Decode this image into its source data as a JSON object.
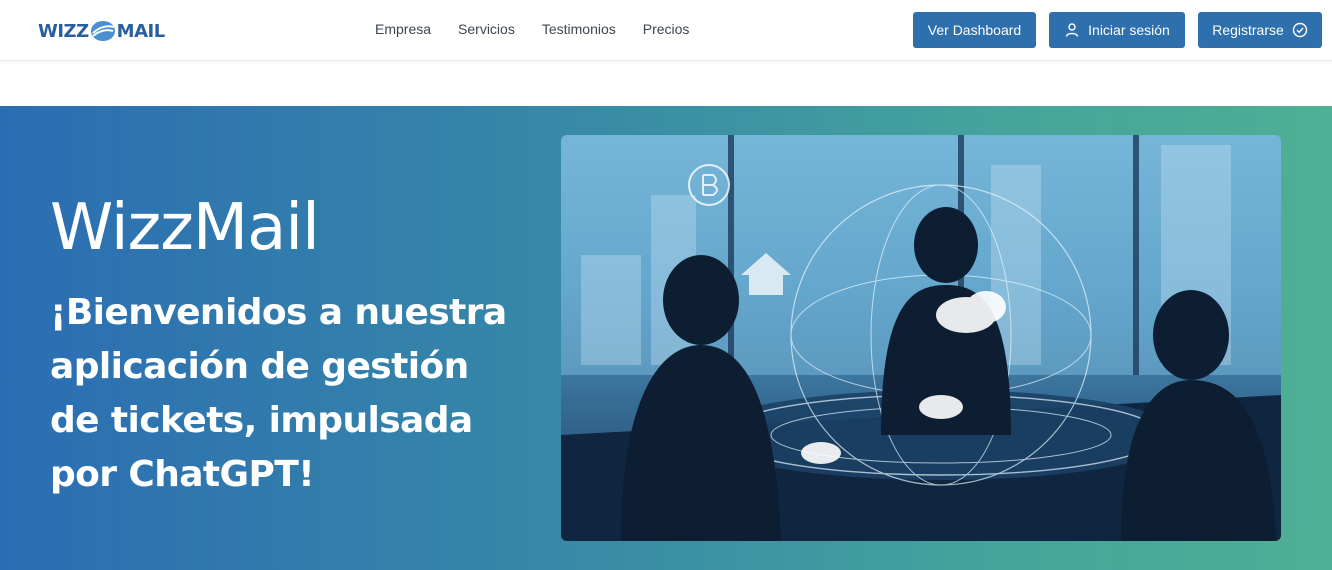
{
  "header": {
    "logo": {
      "left_text": "WIZZ",
      "right_text": "MAIL"
    },
    "nav": [
      "Empresa",
      "Servicios",
      "Testimonios",
      "Precios"
    ],
    "buttons": {
      "dashboard": "Ver Dashboard",
      "login": "Iniciar sesión",
      "register": "Registrarse"
    }
  },
  "hero": {
    "title": "WizzMail",
    "subtitle": "¡Bienvenidos a nuestra aplicación de gestión de tickets, impulsada por ChatGPT!",
    "image_icon": "business-meeting-network-illustration"
  },
  "colors": {
    "brand": "#2e6fad",
    "logo": "#2a5f9e",
    "gradient_start": "#2b6db3",
    "gradient_end": "#4eb094"
  }
}
